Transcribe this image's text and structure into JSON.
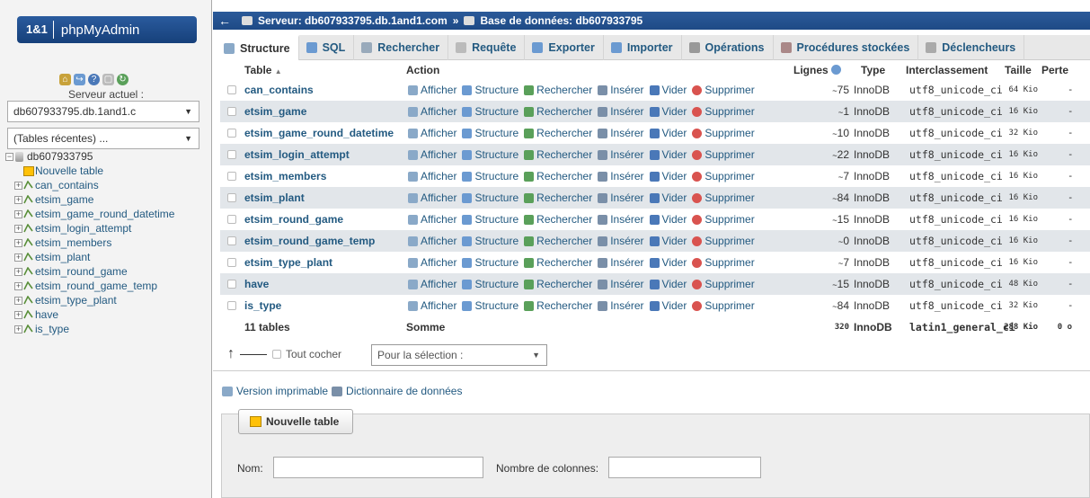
{
  "logo": {
    "brand": "1&1",
    "name": "phpMyAdmin"
  },
  "sidebar": {
    "server_label": "Serveur actuel :",
    "server_value": "db607933795.db.1and1.c",
    "recent_value": "(Tables récentes) ...",
    "db_name": "db607933795",
    "new_table": "Nouvelle table",
    "tables": [
      "can_contains",
      "etsim_game",
      "etsim_game_round_datetime",
      "etsim_login_attempt",
      "etsim_members",
      "etsim_plant",
      "etsim_round_game",
      "etsim_round_game_temp",
      "etsim_type_plant",
      "have",
      "is_type"
    ]
  },
  "breadcrumb": {
    "back": "←",
    "server": "Serveur: db607933795.db.1and1.com",
    "sep": "»",
    "database": "Base de données: db607933795"
  },
  "tabs": [
    "Structure",
    "SQL",
    "Rechercher",
    "Requête",
    "Exporter",
    "Importer",
    "Opérations",
    "Procédures stockées",
    "Déclencheurs"
  ],
  "table": {
    "headers": {
      "table": "Table",
      "sort": "▲",
      "action": "Action",
      "rows": "Lignes",
      "type": "Type",
      "collation": "Interclassement",
      "size": "Taille",
      "overhead": "Perte"
    },
    "action_labels": [
      "Afficher",
      "Structure",
      "Rechercher",
      "Insérer",
      "Vider",
      "Supprimer"
    ],
    "rows": [
      {
        "name": "can_contains",
        "rows": "75",
        "engine": "InnoDB",
        "collation": "utf8_unicode_ci",
        "size": "64 Kio",
        "overhead": "-"
      },
      {
        "name": "etsim_game",
        "rows": "1",
        "engine": "InnoDB",
        "collation": "utf8_unicode_ci",
        "size": "16 Kio",
        "overhead": "-"
      },
      {
        "name": "etsim_game_round_datetime",
        "rows": "10",
        "engine": "InnoDB",
        "collation": "utf8_unicode_ci",
        "size": "32 Kio",
        "overhead": "-"
      },
      {
        "name": "etsim_login_attempt",
        "rows": "22",
        "engine": "InnoDB",
        "collation": "utf8_unicode_ci",
        "size": "16 Kio",
        "overhead": "-"
      },
      {
        "name": "etsim_members",
        "rows": "7",
        "engine": "InnoDB",
        "collation": "utf8_unicode_ci",
        "size": "16 Kio",
        "overhead": "-"
      },
      {
        "name": "etsim_plant",
        "rows": "84",
        "engine": "InnoDB",
        "collation": "utf8_unicode_ci",
        "size": "16 Kio",
        "overhead": "-"
      },
      {
        "name": "etsim_round_game",
        "rows": "15",
        "engine": "InnoDB",
        "collation": "utf8_unicode_ci",
        "size": "16 Kio",
        "overhead": "-"
      },
      {
        "name": "etsim_round_game_temp",
        "rows": "0",
        "engine": "InnoDB",
        "collation": "utf8_unicode_ci",
        "size": "16 Kio",
        "overhead": "-"
      },
      {
        "name": "etsim_type_plant",
        "rows": "7",
        "engine": "InnoDB",
        "collation": "utf8_unicode_ci",
        "size": "16 Kio",
        "overhead": "-"
      },
      {
        "name": "have",
        "rows": "15",
        "engine": "InnoDB",
        "collation": "utf8_unicode_ci",
        "size": "48 Kio",
        "overhead": "-"
      },
      {
        "name": "is_type",
        "rows": "84",
        "engine": "InnoDB",
        "collation": "utf8_unicode_ci",
        "size": "32 Kio",
        "overhead": "-"
      }
    ],
    "summary": {
      "name": "11 tables",
      "action": "Somme",
      "rows": "320",
      "engine": "InnoDB",
      "collation": "latin1_general_ci",
      "size": "288 Kio",
      "overhead": "0 o"
    }
  },
  "footer": {
    "check_all": "Tout cocher",
    "with_selected": "Pour la sélection :"
  },
  "links": {
    "print": "Version imprimable",
    "dictionary": "Dictionnaire de données"
  },
  "new_table_form": {
    "button": "Nouvelle table",
    "name_label": "Nom:",
    "columns_label": "Nombre de colonnes:"
  },
  "colors": {
    "link": "#235a81",
    "header_blue": "#1e4a86",
    "row_alt": "#e2e6ea"
  }
}
